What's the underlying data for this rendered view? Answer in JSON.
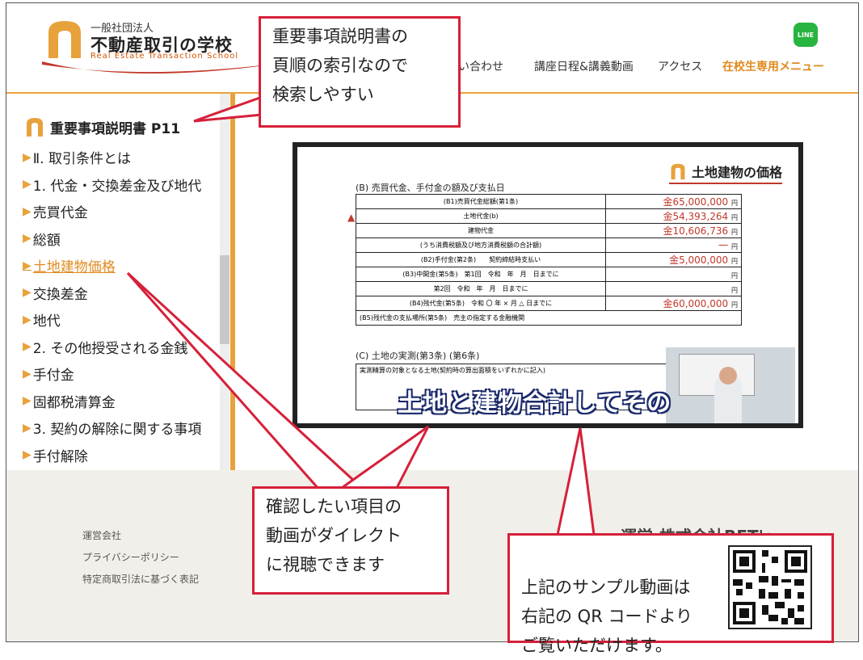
{
  "header": {
    "logo_small": "一般社団法人",
    "logo_main": "不動産取引の学校",
    "logo_en": "Real Estate Transaction School",
    "nav": [
      {
        "label": "問い合わせ"
      },
      {
        "label": "講座日程&講義動画"
      },
      {
        "label": "アクセス"
      },
      {
        "label": "在校生専用メニュー"
      }
    ],
    "line_label": "LINE"
  },
  "sidebar": {
    "title": "重要事項説明書 P11",
    "items": [
      {
        "label": "Ⅱ. 取引条件とは"
      },
      {
        "label": "1. 代金・交換差金及び地代"
      },
      {
        "label": "売買代金"
      },
      {
        "label": "総額"
      },
      {
        "label": "土地建物価格"
      },
      {
        "label": "交換差金"
      },
      {
        "label": "地代"
      },
      {
        "label": "2. その他授受される金銭"
      },
      {
        "label": "手付金"
      },
      {
        "label": "固都税清算金"
      },
      {
        "label": "3. 契約の解除に関する事項"
      },
      {
        "label": "手付解除"
      }
    ]
  },
  "video": {
    "slide_title": "土地建物の価格",
    "section_b": "(B) 売買代金、手付金の額及び支払日",
    "rows": [
      {
        "label": "(B1)売買代金総額(第1条)",
        "value": "金65,000,000",
        "unit": "円"
      },
      {
        "label": "土地代金(b)",
        "value": "金54,393,264",
        "unit": "円"
      },
      {
        "label": "建物代金",
        "value": "金10,606,736",
        "unit": "円"
      },
      {
        "label": "(うち消費税額及び地方消費税額の合計額)",
        "value": "一",
        "unit": "円"
      },
      {
        "label": "(B2)手付金(第2条)　　契約締結時支払い",
        "value": "金5,000,000",
        "unit": "円"
      },
      {
        "label": "(B3)中間金(第5条)　第1回　令和　年　月　日までに",
        "value": "",
        "unit": "円"
      },
      {
        "label": "第2回　令和　年　月　日までに",
        "value": "",
        "unit": "円"
      },
      {
        "label": "(B4)残代金(第5条)　令和 〇 年 × 月 △ 日までに",
        "value": "金60,000,000",
        "unit": "円"
      },
      {
        "label": "(B5)残代金の支払場所(第5条)　売主の指定する金融機関",
        "value": "",
        "unit": ""
      }
    ],
    "section_c": "(C) 土地の実測(第3条) (第6条)",
    "survey_text": "実測精算の対象となる土地(契約時の算出面積をいずれかに記入)",
    "subtitle": "土地と建物合計してその"
  },
  "footer": {
    "links": [
      {
        "label": "運営会社"
      },
      {
        "label": "プライバシーポリシー"
      },
      {
        "label": "特定商取引法に基づく表記"
      }
    ],
    "company": "運営:株式会社RET's"
  },
  "callouts": {
    "index_note": "重要事項説明書の\n頁順の索引なので\n検索しやすい",
    "direct_note": "確認したい項目の\n動画がダイレクト\nに視聴できます",
    "qr_note": "上記のサンプル動画は\n右記の QR コードより\nご覧いただけます。"
  },
  "colors": {
    "brand_orange": "#e8a23c",
    "callout_red": "#d6203a",
    "line_green": "#27b43f"
  }
}
